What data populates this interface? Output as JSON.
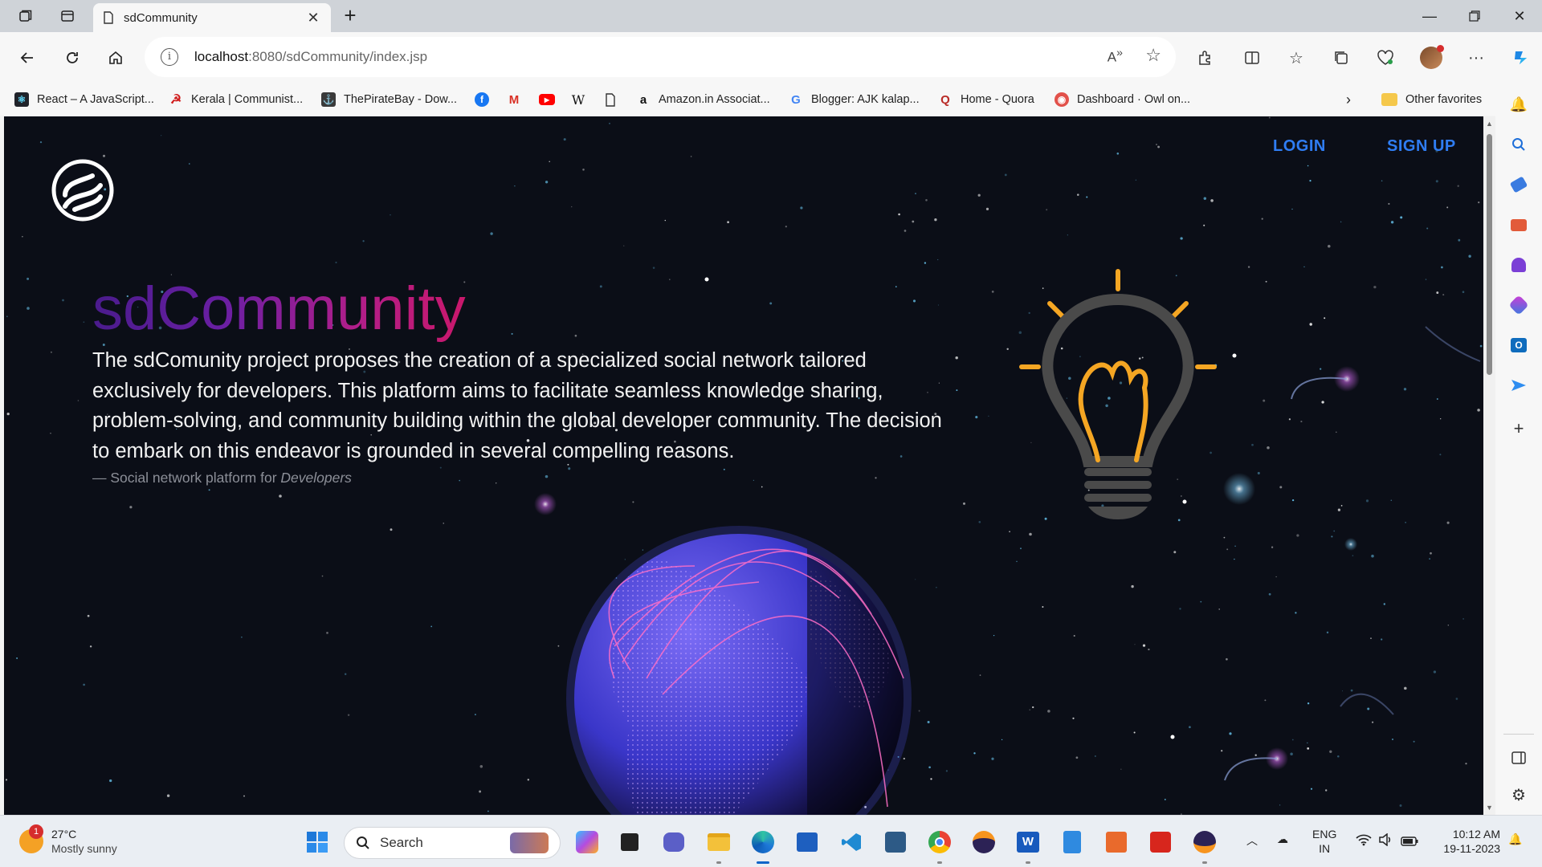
{
  "browser": {
    "tab": {
      "title": "sdCommunity"
    },
    "address": {
      "host": "localhost",
      "path": ":8080/sdCommunity/index.jsp"
    },
    "favorites": [
      {
        "label": "React – A JavaScript...",
        "icon": "react-icon"
      },
      {
        "label": "Kerala | Communist...",
        "icon": "hammer-sickle-icon"
      },
      {
        "label": "ThePirateBay - Dow...",
        "icon": "pirate-ship-icon"
      },
      {
        "label": "",
        "icon": "facebook-icon"
      },
      {
        "label": "",
        "icon": "gmail-icon"
      },
      {
        "label": "",
        "icon": "youtube-icon"
      },
      {
        "label": "",
        "icon": "wikipedia-icon"
      },
      {
        "label": "",
        "icon": "document-icon"
      },
      {
        "label": "Amazon.in Associat...",
        "icon": "amazon-icon"
      },
      {
        "label": "Blogger: AJK kalap...",
        "icon": "google-icon"
      },
      {
        "label": "Home - Quora",
        "icon": "quora-icon"
      },
      {
        "label": "Dashboard · Owl on...",
        "icon": "owl-icon"
      }
    ],
    "other_favorites": "Other favorites"
  },
  "page": {
    "nav": {
      "login": "LOGIN",
      "signup": "SIGN UP"
    },
    "title": "sdCommunity",
    "description": "The sdComunity project proposes the creation of a specialized social network tailored exclusively for developers. This platform aims to facilitate seamless knowledge sharing, problem-solving, and community building within the global developer community. The decision to embark on this endeavor is grounded in several compelling reasons.",
    "caption_prefix": "— Social network platform for ",
    "caption_emphasis": "Developers"
  },
  "colors": {
    "background": "#0b0e17",
    "link": "#2f7df3",
    "bulb_accent": "#f5a623",
    "bulb_body": "#4a4a4a"
  },
  "taskbar": {
    "weather": {
      "temp": "27°C",
      "desc": "Mostly sunny",
      "badge": "1"
    },
    "search_placeholder": "Search",
    "lang": {
      "line1": "ENG",
      "line2": "IN"
    },
    "clock": {
      "time": "10:12 AM",
      "date": "19-11-2023"
    }
  }
}
